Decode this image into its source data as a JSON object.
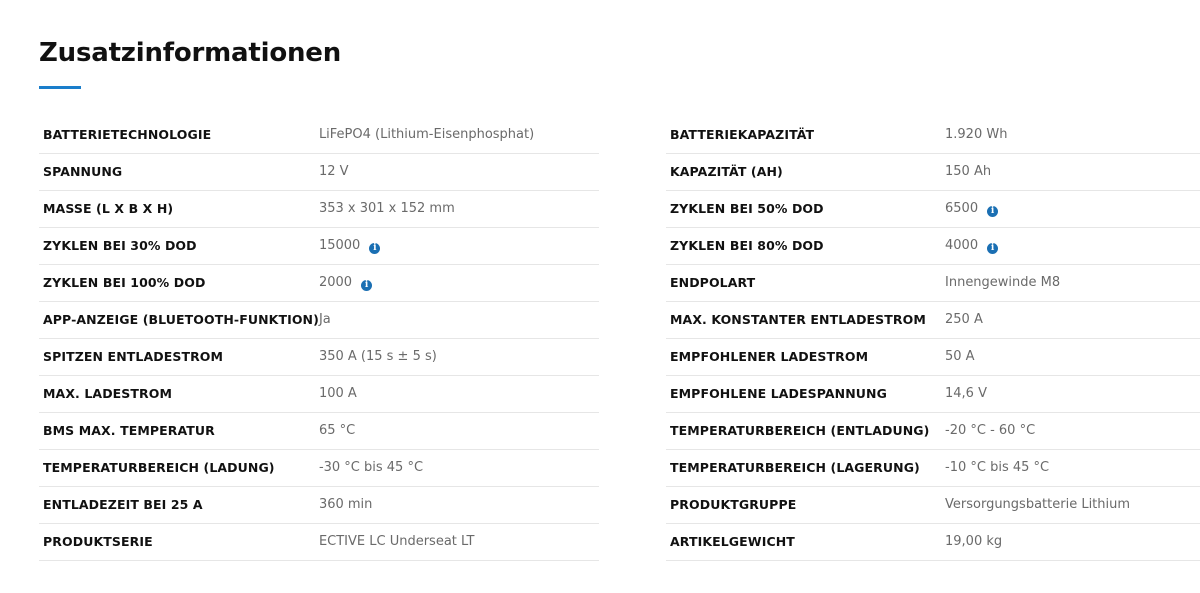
{
  "heading": "Zusatzinformationen",
  "colors": {
    "accent": "#1a7ecb",
    "info_icon": "#1a6fb3",
    "label_text": "#111111",
    "value_text": "#6a6a6a",
    "row_divider": "#e6e6e6"
  },
  "icons": {
    "info": "i"
  },
  "left_table": [
    {
      "label": "BATTERIETECHNOLOGIE",
      "value": "LiFePO4 (Lithium-Eisenphosphat)",
      "info": false
    },
    {
      "label": "SPANNUNG",
      "value": "12 V",
      "info": false
    },
    {
      "label": "MASSE (L X B X H)",
      "value": "353 x 301 x 152 mm",
      "info": false
    },
    {
      "label": "ZYKLEN BEI 30% DOD",
      "value": "15000",
      "info": true
    },
    {
      "label": "ZYKLEN BEI 100% DOD",
      "value": "2000",
      "info": true
    },
    {
      "label": "APP-ANZEIGE (BLUETOOTH-FUNKTION)",
      "value": "Ja",
      "info": false
    },
    {
      "label": "SPITZEN ENTLADESTROM",
      "value": "350 A (15 s ± 5 s)",
      "info": false
    },
    {
      "label": "MAX. LADESTROM",
      "value": "100 A",
      "info": false
    },
    {
      "label": "BMS MAX. TEMPERATUR",
      "value": "65 °C",
      "info": false
    },
    {
      "label": "TEMPERATURBEREICH (LADUNG)",
      "value": "-30 °C bis 45 °C",
      "info": false
    },
    {
      "label": "ENTLADEZEIT BEI 25 A",
      "value": "360 min",
      "info": false
    },
    {
      "label": "PRODUKTSERIE",
      "value": "ECTIVE LC Underseat LT",
      "info": false
    }
  ],
  "right_table": [
    {
      "label": "BATTERIEKAPAZITÄT",
      "value": "1.920 Wh",
      "info": false
    },
    {
      "label": "KAPAZITÄT (AH)",
      "value": "150 Ah",
      "info": false
    },
    {
      "label": "ZYKLEN BEI 50% DOD",
      "value": "6500",
      "info": true
    },
    {
      "label": "ZYKLEN BEI 80% DOD",
      "value": "4000",
      "info": true
    },
    {
      "label": "ENDPOLART",
      "value": "Innengewinde M8",
      "info": false
    },
    {
      "label": "MAX. KONSTANTER ENTLADESTROM",
      "value": "250 A",
      "info": false
    },
    {
      "label": "EMPFOHLENER LADESTROM",
      "value": "50 A",
      "info": false
    },
    {
      "label": "EMPFOHLENE LADESPANNUNG",
      "value": "14,6 V",
      "info": false
    },
    {
      "label": "TEMPERATURBEREICH (ENTLADUNG)",
      "value": "-20 °C - 60 °C",
      "info": false
    },
    {
      "label": "TEMPERATURBEREICH (LAGERUNG)",
      "value": "-10 °C bis 45 °C",
      "info": false
    },
    {
      "label": "PRODUKTGRUPPE",
      "value": "Versorgungsbatterie Lithium",
      "info": false
    },
    {
      "label": "ARTIKELGEWICHT",
      "value": "19,00 kg",
      "info": false
    }
  ]
}
